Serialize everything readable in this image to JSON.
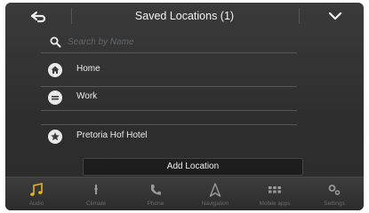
{
  "header": {
    "title": "Saved Locations (1)",
    "back_icon": "back-arrow-icon",
    "collapse_icon": "chevron-down-icon"
  },
  "search": {
    "placeholder": "Search by Name",
    "icon": "search-icon"
  },
  "locations": [
    {
      "label": "Home",
      "icon": "home-icon"
    },
    {
      "label": "Work",
      "icon": "work-icon"
    },
    {
      "label": "Pretoria Hof Hotel",
      "icon": "star-icon"
    }
  ],
  "add_location_label": "Add Location",
  "bottom_nav": [
    {
      "label": "Audio",
      "icon": "music-note-icon",
      "active": true
    },
    {
      "label": "Climate",
      "icon": "climate-icon"
    },
    {
      "label": "Phone",
      "icon": "phone-icon"
    },
    {
      "label": "Navigation",
      "icon": "navigation-icon"
    },
    {
      "label": "Mobile apps",
      "icon": "apps-grid-icon"
    },
    {
      "label": "Settings",
      "icon": "settings-icon"
    }
  ],
  "colors": {
    "background": "#333333",
    "accent_audio": "#e6b422",
    "text": "#ededed",
    "muted_text": "#6c6c6c"
  }
}
